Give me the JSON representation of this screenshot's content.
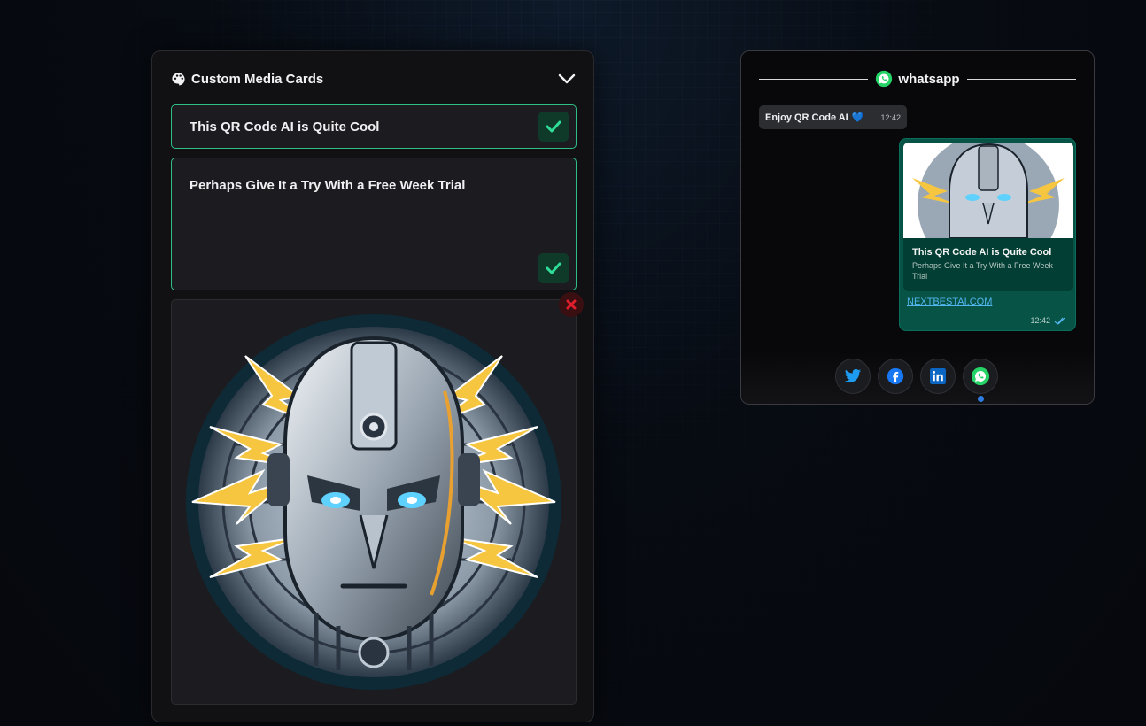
{
  "editor": {
    "title": "Custom Media Cards",
    "title_field_value": "This QR Code AI is Quite Cool",
    "description_field_value": "Perhaps Give It a Try With a Free Week Trial",
    "image_alt": "AI robot head illustration"
  },
  "preview": {
    "platform": "whatsapp",
    "incoming_message": "Enjoy QR Code AI",
    "incoming_emoji": "💙",
    "incoming_time": "12:42",
    "card_title": "This QR Code AI is Quite Cool",
    "card_description": "Perhaps Give It a Try With a Free Week Trial",
    "link_text": "NEXTBESTAI.COM",
    "outgoing_time": "12:42"
  },
  "share": {
    "buttons": [
      {
        "name": "twitter"
      },
      {
        "name": "facebook"
      },
      {
        "name": "linkedin"
      },
      {
        "name": "whatsapp"
      }
    ],
    "active_index": 3
  },
  "colors": {
    "accent_green": "#2fbf86",
    "whatsapp_green": "#25d366",
    "outgoing_bubble": "#075346",
    "remove_red": "#e01e2c",
    "link_blue": "#53b6ee"
  }
}
